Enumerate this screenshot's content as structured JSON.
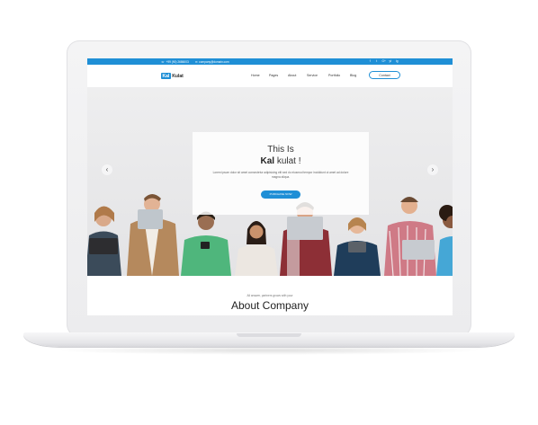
{
  "topbar": {
    "phone": "+99 (90) 2686003",
    "email": "company@domain.com",
    "socials": [
      "f",
      "t",
      "G+",
      "yt",
      "ig"
    ]
  },
  "header": {
    "logo_box": "Kal",
    "logo_text": "Kulat",
    "nav": [
      "Home",
      "Pages",
      "About",
      "Service",
      "Portfolio",
      "Blog"
    ],
    "contact": "Contact"
  },
  "hero": {
    "line1": "This Is",
    "brand_bold": "Kal",
    "brand_rest": " kulat !",
    "subtitle": "Lorem ipsum dolor sit amet consectetur adipisicing elit sed do eiusmod tempor incididunt ut amet ad dolore magna aliqua.",
    "button": "PURCHASE NOW",
    "prev": "‹",
    "next": "›"
  },
  "about": {
    "small": "All answer, partners grows with your",
    "title": "About Company"
  },
  "colors": {
    "accent": "#1f8fd6"
  }
}
